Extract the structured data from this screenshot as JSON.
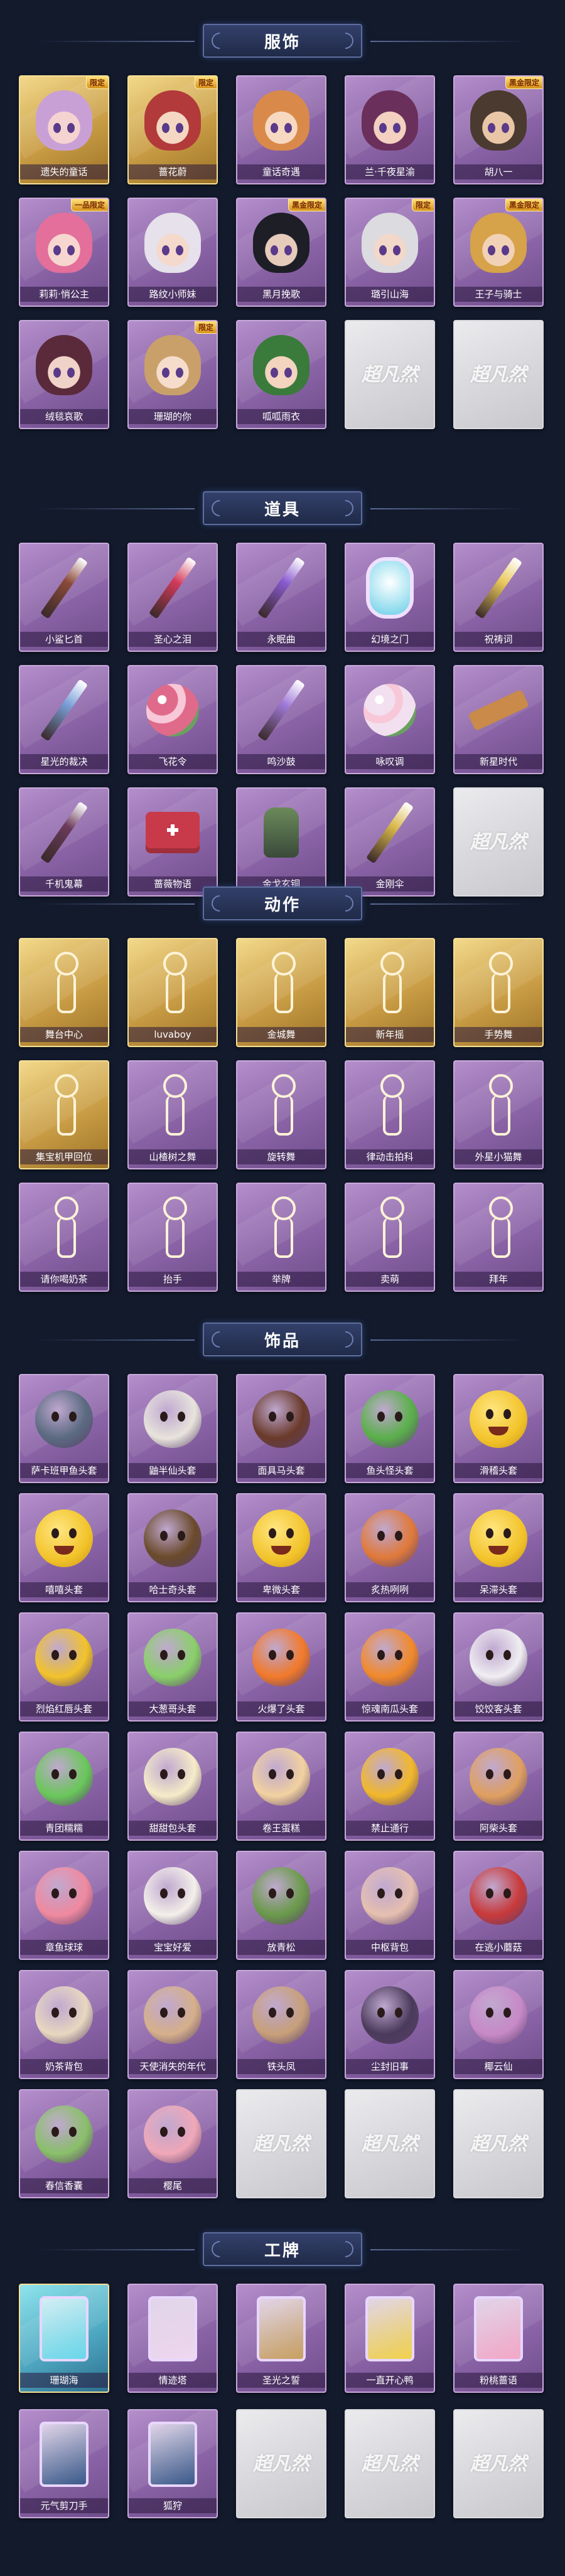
{
  "sections": [
    {
      "title": "服饰",
      "items": [
        {
          "label": "遗失的童话",
          "badge": "限定",
          "gold": true,
          "art": "avatar",
          "hair": "#c9a0d6",
          "skin": "#f5d3d0"
        },
        {
          "label": "蔷花蔚",
          "badge": "限定",
          "gold": true,
          "art": "avatar",
          "hair": "#b23a3a",
          "skin": "#f5d8c4"
        },
        {
          "label": "童话奇遇",
          "art": "avatar",
          "hair": "#d98a4a",
          "skin": "#f7d9c2"
        },
        {
          "label": "兰·千夜星渝",
          "art": "avatar",
          "hair": "#6a2f5a",
          "skin": "#f3d0c0"
        },
        {
          "label": "胡八一",
          "badge": "黑金限定",
          "art": "avatar",
          "hair": "#4a3a30",
          "skin": "#e9c7a6"
        },
        {
          "label": "莉莉·悄公主",
          "badge": "一品限定",
          "art": "avatar",
          "hair": "#e36f9a",
          "skin": "#f6d6cf"
        },
        {
          "label": "路纹小师妹",
          "art": "avatar",
          "hair": "#e6e1ea",
          "skin": "#f4d9cc"
        },
        {
          "label": "黑月挽歌",
          "badge": "黑金限定",
          "art": "avatar",
          "hair": "#1e1e26",
          "skin": "#e6cbbb"
        },
        {
          "label": "璐引山海",
          "badge": "限定",
          "art": "avatar",
          "hair": "#dcdbe0",
          "skin": "#f2d8c8"
        },
        {
          "label": "王子与骑士",
          "badge": "黑金限定",
          "art": "avatar",
          "hair": "#d6a24a",
          "skin": "#f2d2b6"
        },
        {
          "label": "绒毯哀歌",
          "art": "avatar",
          "hair": "#5a2a3a",
          "skin": "#f0d3c8"
        },
        {
          "label": "珊瑚的你",
          "badge": "限定",
          "art": "avatar",
          "hair": "#c9a06a",
          "skin": "#f6dccb"
        },
        {
          "label": "呱呱雨衣",
          "art": "avatar",
          "hair": "#3a7a3a",
          "skin": "#f2d4bf"
        },
        {
          "placeholder": true
        },
        {
          "placeholder": true
        }
      ]
    },
    {
      "title": "道具",
      "items": [
        {
          "label": "小鲨匕首",
          "art": "blade",
          "color": "#8a4a3a"
        },
        {
          "label": "圣心之泪",
          "art": "blade",
          "color": "#d23a5a"
        },
        {
          "label": "永眠曲",
          "art": "blade",
          "color": "#8a5ad0"
        },
        {
          "label": "幻境之门",
          "art": "mirror",
          "color": "#6ad0e8"
        },
        {
          "label": "祝祷词",
          "art": "blade",
          "color": "#e8c85a"
        },
        {
          "label": "星光的裁决",
          "art": "blade",
          "color": "#7aa0d8"
        },
        {
          "label": "飞花令",
          "art": "flower",
          "color": "#e06a8a"
        },
        {
          "label": "鸣沙鼓",
          "art": "blade",
          "color": "#a07ad8"
        },
        {
          "label": "咏叹调",
          "art": "flower",
          "color": "#f2e0f0"
        },
        {
          "label": "新星时代",
          "art": "gun",
          "color": "#c98a4a"
        },
        {
          "label": "千机鬼幕",
          "art": "blade",
          "color": "#6a3a5a"
        },
        {
          "label": "蔷薇物语",
          "art": "box",
          "color": "#c83a4a"
        },
        {
          "label": "金戈玄铜",
          "art": "lantern",
          "color": "#6a8a5a"
        },
        {
          "label": "金刚伞",
          "art": "blade",
          "color": "#d8b84a"
        },
        {
          "placeholder": true
        }
      ]
    },
    {
      "title": "动作",
      "items": [
        {
          "label": "舞台中心",
          "gold": true,
          "art": "pose"
        },
        {
          "label": "luvaboy",
          "gold": true,
          "art": "pose"
        },
        {
          "label": "金城舞",
          "gold": true,
          "art": "pose"
        },
        {
          "label": "新年摇",
          "gold": true,
          "art": "pose"
        },
        {
          "label": "手势舞",
          "gold": true,
          "art": "pose"
        },
        {
          "label": "集宝机甲回位",
          "gold": true,
          "art": "pose"
        },
        {
          "label": "山楂树之舞",
          "art": "pose"
        },
        {
          "label": "旋转舞",
          "art": "pose"
        },
        {
          "label": "律动击拍科",
          "art": "pose"
        },
        {
          "label": "外星小猫舞",
          "art": "pose"
        },
        {
          "label": "请你喝奶茶",
          "art": "pose"
        },
        {
          "label": "抬手",
          "art": "pose"
        },
        {
          "label": "举牌",
          "art": "pose"
        },
        {
          "label": "卖萌",
          "art": "pose"
        },
        {
          "label": "拜年",
          "art": "pose"
        }
      ]
    },
    {
      "title": "饰品",
      "items": [
        {
          "label": "萨卡班甲鱼头套",
          "art": "mask",
          "color": "#5a6a80"
        },
        {
          "label": "鼬半仙头套",
          "art": "mask",
          "color": "#e8e4dc"
        },
        {
          "label": "面具马头套",
          "art": "mask",
          "color": "#6a3a2a"
        },
        {
          "label": "鱼头怪头套",
          "art": "mask",
          "color": "#5ab04a"
        },
        {
          "label": "滑稽头套",
          "art": "smile",
          "color": "#f2c32a"
        },
        {
          "label": "嘻嘻头套",
          "art": "smile",
          "color": "#f2c32a"
        },
        {
          "label": "哈士奇头套",
          "art": "mask",
          "color": "#6a4a2a"
        },
        {
          "label": "卑微头套",
          "art": "smile",
          "color": "#f2c32a"
        },
        {
          "label": "炙热咧咧",
          "art": "mask",
          "color": "#e07a3a"
        },
        {
          "label": "呆滞头套",
          "art": "smile",
          "color": "#f2c32a"
        },
        {
          "label": "烈焰红唇头套",
          "art": "mask",
          "color": "#f2c32a"
        },
        {
          "label": "大葱哥头套",
          "art": "mask",
          "color": "#8ad06a"
        },
        {
          "label": "火爆了头套",
          "art": "mask",
          "color": "#f27a2a"
        },
        {
          "label": "惊魂南瓜头套",
          "art": "mask",
          "color": "#f28a2a"
        },
        {
          "label": "饺饺客头套",
          "art": "mask",
          "color": "#f0eef2"
        },
        {
          "label": "青团糯糯",
          "art": "mask",
          "color": "#6ac85a"
        },
        {
          "label": "甜甜包头套",
          "art": "mask",
          "color": "#f6ecc8"
        },
        {
          "label": "卷王蛋糕",
          "art": "mask",
          "color": "#f2d2a0"
        },
        {
          "label": "禁止通行",
          "art": "mask",
          "color": "#f2b82a"
        },
        {
          "label": "阿柴头套",
          "art": "mask",
          "color": "#e0a060"
        },
        {
          "label": "章鱼球球",
          "art": "mask",
          "color": "#f08aa0"
        },
        {
          "label": "宝宝好爱",
          "art": "mask",
          "color": "#f4f0ea"
        },
        {
          "label": "放青松",
          "art": "mask",
          "color": "#6a9a4a"
        },
        {
          "label": "中枢背包",
          "art": "mask",
          "color": "#e6c0b0"
        },
        {
          "label": "在逃小蘑菇",
          "art": "mask",
          "color": "#c83a3a"
        },
        {
          "label": "奶茶背包",
          "art": "mask",
          "color": "#e8d8c0"
        },
        {
          "label": "天使消失的年代",
          "art": "mask",
          "color": "#d6b08a"
        },
        {
          "label": "铁头凤",
          "art": "mask",
          "color": "#c8a07a"
        },
        {
          "label": "尘封旧事",
          "art": "mask",
          "color": "#4a3a5a"
        },
        {
          "label": "椰云仙",
          "art": "mask",
          "color": "#c88ac8"
        },
        {
          "label": "春信香囊",
          "art": "mask",
          "color": "#8ac06a"
        },
        {
          "label": "樱尾",
          "art": "mask",
          "color": "#f0a8b8"
        },
        {
          "placeholder": true
        },
        {
          "placeholder": true
        },
        {
          "placeholder": true
        }
      ]
    },
    {
      "title": "工牌",
      "items": [
        {
          "label": "珊瑚海",
          "gold": true,
          "teal": true,
          "art": "cardbox",
          "color": "#6ad8ea"
        },
        {
          "label": "情迹塔",
          "art": "cardbox",
          "color": "#f0d8f0"
        },
        {
          "label": "圣光之誓",
          "art": "cardbox",
          "color": "#c8a060"
        },
        {
          "label": "一直开心鸭",
          "art": "cardbox",
          "color": "#f2d24a"
        },
        {
          "label": "粉桃蔷语",
          "art": "cardbox",
          "color": "#f4a8c8"
        },
        {
          "label": "元气剪刀手",
          "art": "cardbox",
          "color": "#3a5a8a"
        },
        {
          "label": "狐狩",
          "art": "cardbox",
          "color": "#3a5a8a"
        },
        {
          "placeholder": true
        },
        {
          "placeholder": true
        },
        {
          "placeholder": true
        }
      ]
    }
  ],
  "placeholder_logo": "超凡然"
}
